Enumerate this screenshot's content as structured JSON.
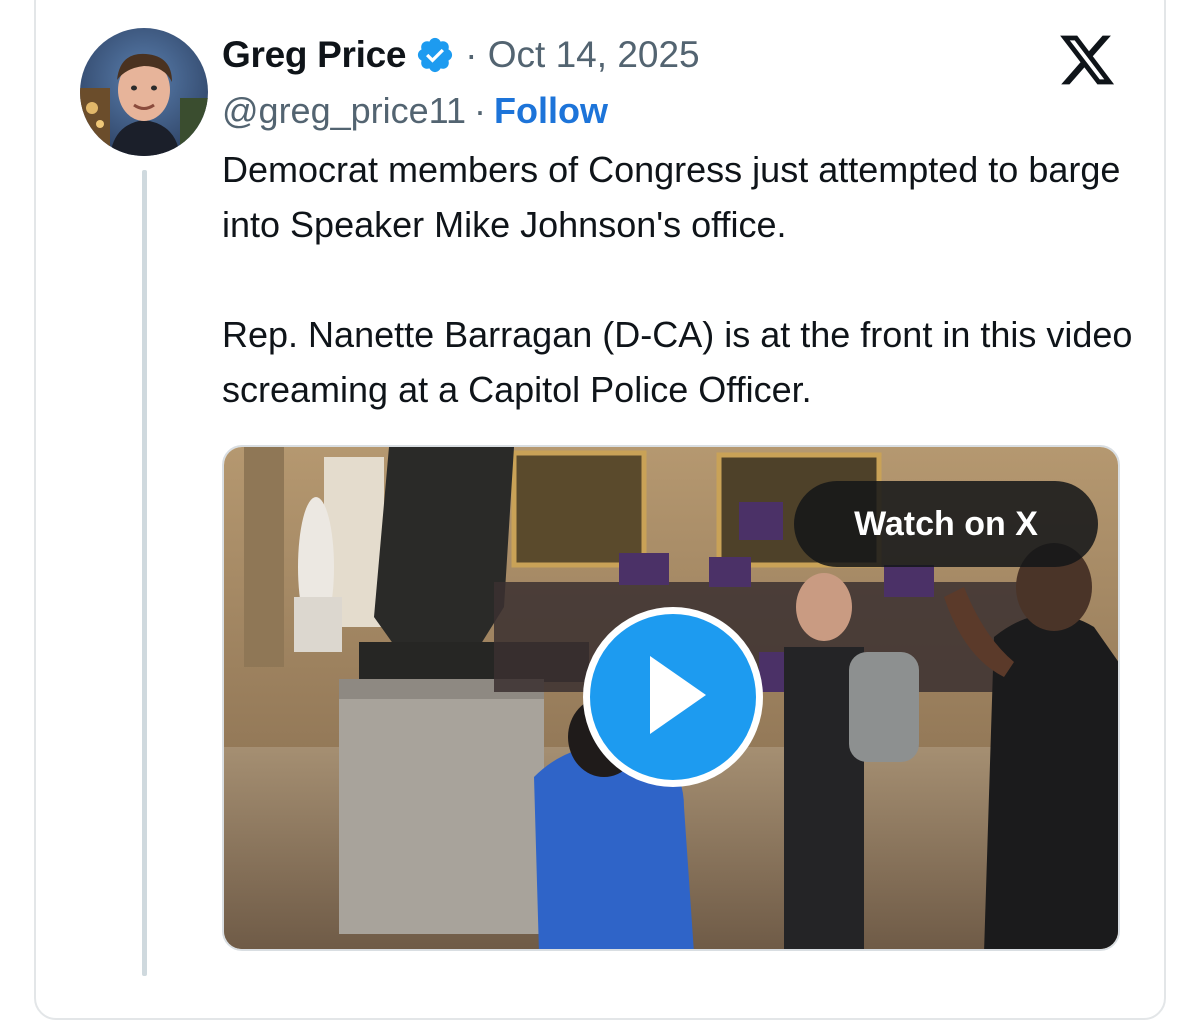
{
  "tweet": {
    "author_name": "Greg Price",
    "date": "Oct 14, 2025",
    "date_separator": "·",
    "handle": "@greg_price11",
    "handle_separator": "·",
    "follow_label": "Follow",
    "text_paragraphs": [
      "Democrat members of Congress just attempted to barge into Speaker Mike Johnson's office.",
      "Rep. Nanette Barragan (D-CA) is at the front in this video screaming at a Capitol Police Officer."
    ],
    "verified": true
  },
  "media": {
    "watch_label": "Watch on X",
    "play_icon": "play-icon"
  },
  "icons": {
    "brand": "x-logo-icon",
    "badge": "verified-badge-icon"
  },
  "colors": {
    "accent": "#1d9bf0",
    "link": "#1d74d9",
    "muted": "#536471",
    "text": "#0f1419"
  }
}
